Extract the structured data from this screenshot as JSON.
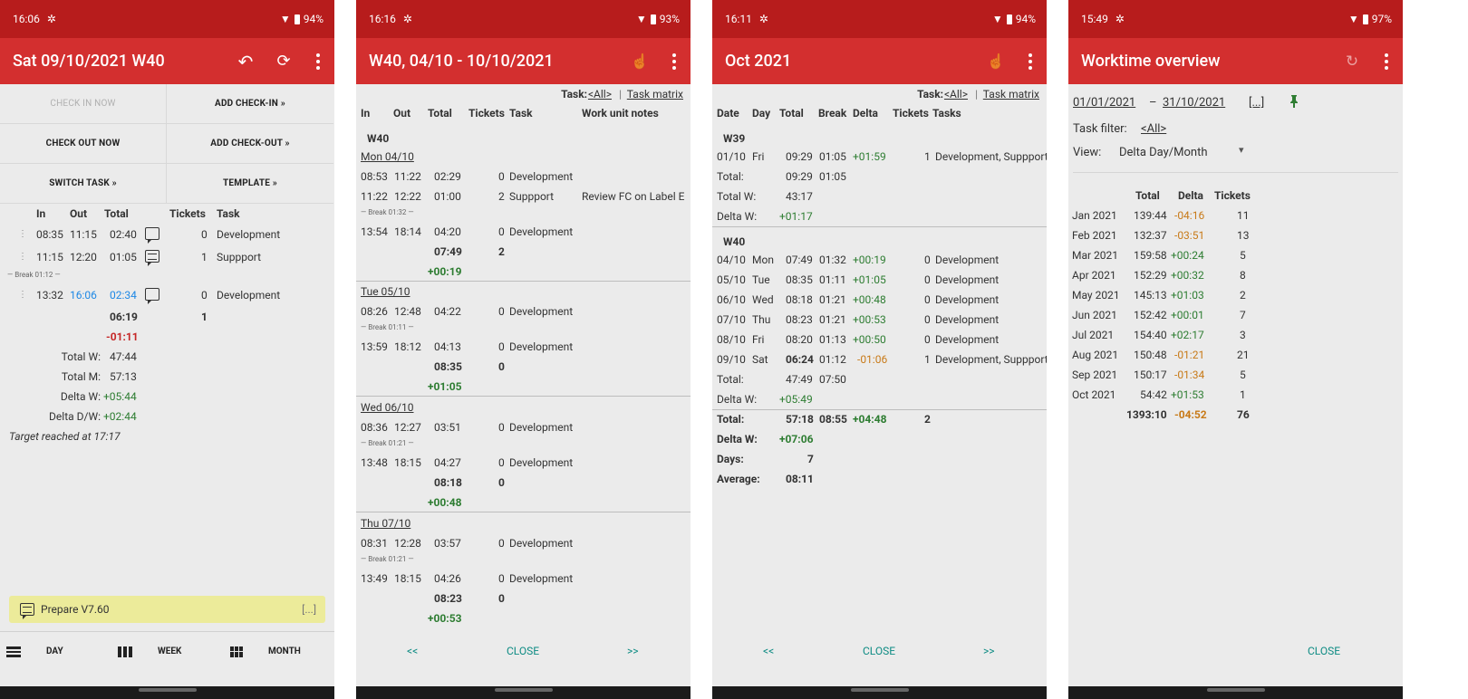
{
  "screen1": {
    "status": {
      "time": "16:06",
      "battery": "94%"
    },
    "title": "Sat 09/10/2021 W40",
    "buttons": {
      "check_in_now": "CHECK IN NOW",
      "add_check_in": "ADD CHECK-IN »",
      "check_out_now": "CHECK OUT NOW",
      "add_check_out": "ADD CHECK-OUT »",
      "switch_task": "SWITCH TASK »",
      "template": "TEMPLATE »"
    },
    "headers": {
      "in": "In",
      "out": "Out",
      "total": "Total",
      "tickets": "Tickets",
      "task": "Task"
    },
    "rows": [
      {
        "in": "08:35",
        "out": "11:15",
        "total": "02:40",
        "tickets": "0",
        "task": "Development"
      },
      {
        "in": "11:15",
        "out": "12:20",
        "total": "01:05",
        "tickets": "1",
        "task": "Suppport"
      },
      {
        "in": "13:32",
        "out": "16:06",
        "total": "02:34",
        "tickets": "0",
        "task": "Development"
      }
    ],
    "break": "— Break 01:12 —",
    "sum_total": "06:19",
    "sum_tickets": "1",
    "delta_day": "-01:11",
    "total_w_label": "Total W:",
    "total_w": "47:44",
    "total_m_label": "Total M:",
    "total_m": "57:13",
    "delta_w_label": "Delta W:",
    "delta_w": "+05:44",
    "delta_dw_label": "Delta D/W:",
    "delta_dw": "+02:44",
    "target": "Target reached at 17:17",
    "memo": "Prepare V7.60",
    "memo_more": "[...]",
    "tabs": {
      "day": "DAY",
      "week": "WEEK",
      "month": "MONTH"
    }
  },
  "screen2": {
    "status": {
      "time": "16:16",
      "battery": "93%"
    },
    "title": "W40, 04/10 - 10/10/2021",
    "task_label": "Task:",
    "task_all": "<All>",
    "task_matrix": "Task matrix",
    "headers": {
      "in": "In",
      "out": "Out",
      "total": "Total",
      "tickets": "Tickets",
      "task": "Task",
      "notes": "Work unit notes"
    },
    "week": "W40",
    "days": [
      {
        "date": "Mon 04/10",
        "r1": {
          "in": "08:53",
          "out": "11:22",
          "total": "02:29",
          "tickets": "0",
          "task": "Development"
        },
        "r2": {
          "in": "11:22",
          "out": "12:22",
          "total": "01:00",
          "tickets": "2",
          "task": "Suppport",
          "note": "Review FC on Label E"
        },
        "break": "— Break 01:32 —",
        "r3": {
          "in": "13:54",
          "out": "18:14",
          "total": "04:20",
          "tickets": "0",
          "task": "Development"
        },
        "sum": "07:49",
        "sum_tickets": "2",
        "delta": "+00:19"
      },
      {
        "date": "Tue 05/10",
        "r1": {
          "in": "08:26",
          "out": "12:48",
          "total": "04:22",
          "tickets": "0",
          "task": "Development"
        },
        "break": "— Break 01:11 —",
        "r2": {
          "in": "13:59",
          "out": "18:12",
          "total": "04:13",
          "tickets": "0",
          "task": "Development"
        },
        "sum": "08:35",
        "sum_tickets": "0",
        "delta": "+01:05"
      },
      {
        "date": "Wed 06/10",
        "r1": {
          "in": "08:36",
          "out": "12:27",
          "total": "03:51",
          "tickets": "0",
          "task": "Development"
        },
        "break": "— Break 01:21 —",
        "r2": {
          "in": "13:48",
          "out": "18:15",
          "total": "04:27",
          "tickets": "0",
          "task": "Development"
        },
        "sum": "08:18",
        "sum_tickets": "0",
        "delta": "+00:48"
      },
      {
        "date": "Thu 07/10",
        "r1": {
          "in": "08:31",
          "out": "12:28",
          "total": "03:57",
          "tickets": "0",
          "task": "Development"
        },
        "break": "— Break 01:21 —",
        "r2": {
          "in": "13:49",
          "out": "18:15",
          "total": "04:26",
          "tickets": "0",
          "task": "Development"
        },
        "sum": "08:23",
        "sum_tickets": "0",
        "delta": "+00:53"
      }
    ],
    "prev": "<<",
    "close": "CLOSE",
    "next": ">>"
  },
  "screen3": {
    "status": {
      "time": "16:11",
      "battery": "94%"
    },
    "title": "Oct 2021",
    "task_label": "Task:",
    "task_all": "<All>",
    "task_matrix": "Task matrix",
    "headers": {
      "date": "Date",
      "day": "Day",
      "total": "Total",
      "break": "Break",
      "delta": "Delta",
      "tickets": "Tickets",
      "tasks": "Tasks"
    },
    "w39": "W39",
    "w39_row": {
      "date": "01/10",
      "day": "Fri",
      "total": "09:29",
      "break": "01:05",
      "delta": "+01:59",
      "tickets": "1",
      "tasks": "Development, Suppport"
    },
    "w39_total_label": "Total:",
    "w39_total": "09:29",
    "w39_total_break": "01:05",
    "w39_totalw_label": "Total W:",
    "w39_totalw": "43:17",
    "w39_deltaw_label": "Delta W:",
    "w39_deltaw": "+01:17",
    "w40": "W40",
    "w40_rows": [
      {
        "date": "04/10",
        "day": "Mon",
        "total": "07:49",
        "break": "01:32",
        "delta": "+00:19",
        "tickets": "0",
        "tasks": "Development"
      },
      {
        "date": "05/10",
        "day": "Tue",
        "total": "08:35",
        "break": "01:11",
        "delta": "+01:05",
        "tickets": "0",
        "tasks": "Development"
      },
      {
        "date": "06/10",
        "day": "Wed",
        "total": "08:18",
        "break": "01:21",
        "delta": "+00:48",
        "tickets": "0",
        "tasks": "Development"
      },
      {
        "date": "07/10",
        "day": "Thu",
        "total": "08:23",
        "break": "01:21",
        "delta": "+00:53",
        "tickets": "0",
        "tasks": "Development"
      },
      {
        "date": "08/10",
        "day": "Fri",
        "total": "08:20",
        "break": "01:13",
        "delta": "+00:50",
        "tickets": "0",
        "tasks": "Development"
      },
      {
        "date": "09/10",
        "day": "Sat",
        "total": "06:24",
        "break": "01:12",
        "delta": "-01:06",
        "tickets": "1",
        "tasks": "Development, Suppport"
      }
    ],
    "w40_total_label": "Total:",
    "w40_total": "47:49",
    "w40_total_break": "07:50",
    "w40_deltaw_label": "Delta W:",
    "w40_deltaw": "+05:49",
    "grand_total_label": "Total:",
    "grand_total": "57:18",
    "grand_break": "08:55",
    "grand_delta": "+04:48",
    "grand_tickets": "2",
    "grand_deltaw_label": "Delta W:",
    "grand_deltaw": "+07:06",
    "days_label": "Days:",
    "days": "7",
    "avg_label": "Average:",
    "avg": "08:11",
    "prev": "<<",
    "close": "CLOSE",
    "next": ">>"
  },
  "screen4": {
    "status": {
      "time": "15:49",
      "battery": "97%"
    },
    "title": "Worktime overview",
    "date_from": "01/01/2021",
    "date_dash": "–",
    "date_to": "31/10/2021",
    "date_more": "[...]",
    "task_filter_label": "Task filter:",
    "task_filter": "<All>",
    "view_label": "View:",
    "view_value": "Delta Day/Month",
    "headers": {
      "total": "Total",
      "delta": "Delta",
      "tickets": "Tickets"
    },
    "rows": [
      {
        "month": "Jan 2021",
        "total": "139:44",
        "delta": "-04:16",
        "tickets": "11"
      },
      {
        "month": "Feb 2021",
        "total": "132:37",
        "delta": "-03:51",
        "tickets": "13"
      },
      {
        "month": "Mar 2021",
        "total": "159:58",
        "delta": "+00:24",
        "tickets": "5"
      },
      {
        "month": "Apr 2021",
        "total": "152:29",
        "delta": "+00:32",
        "tickets": "8"
      },
      {
        "month": "May 2021",
        "total": "145:13",
        "delta": "+01:03",
        "tickets": "2"
      },
      {
        "month": "Jun 2021",
        "total": "152:42",
        "delta": "+00:01",
        "tickets": "7"
      },
      {
        "month": "Jul 2021",
        "total": "154:40",
        "delta": "+02:17",
        "tickets": "3"
      },
      {
        "month": "Aug 2021",
        "total": "150:48",
        "delta": "-01:21",
        "tickets": "21"
      },
      {
        "month": "Sep 2021",
        "total": "150:17",
        "delta": "-01:34",
        "tickets": "5"
      },
      {
        "month": "Oct 2021",
        "total": "54:42",
        "delta": "+01:53",
        "tickets": "1"
      }
    ],
    "sum_total": "1393:10",
    "sum_delta": "-04:52",
    "sum_tickets": "76",
    "close": "CLOSE"
  },
  "colors": {
    "statusbar": "#b71c1c",
    "appbar": "#d32f2f",
    "positive": "#2e7d32",
    "negative": "#c62828",
    "accent_teal": "#0f8c84",
    "memo": "#eceb9a"
  }
}
